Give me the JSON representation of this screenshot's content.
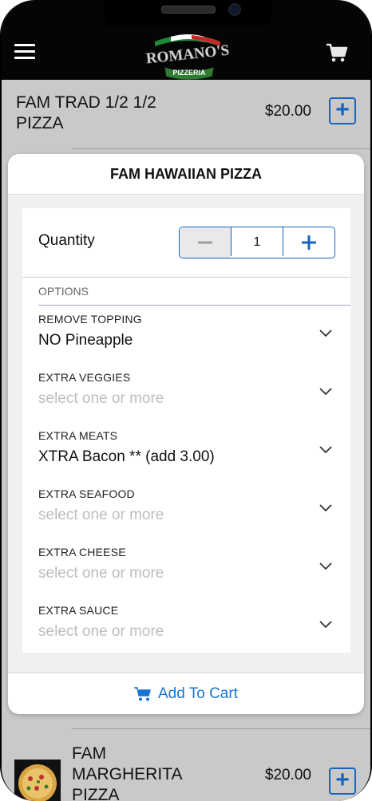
{
  "header": {
    "logo_text": "ROMANO'S",
    "logo_subtext": "PIZZERIA",
    "menu_icon": "hamburger-menu-icon",
    "cart_icon": "shopping-cart-icon"
  },
  "list": {
    "items": [
      {
        "title_line1": "FAM TRAD 1/2 1/2",
        "title_line2": "PIZZA",
        "price": "$20.00"
      },
      {
        "title_line1": "FAM",
        "title_line2": "MARGHERITA",
        "title_line3": "PIZZA",
        "price": "$20.00"
      }
    ]
  },
  "modal": {
    "title": "FAM HAWAIIAN PIZZA",
    "quantity_label": "Quantity",
    "quantity_value": "1",
    "options_header": "OPTIONS",
    "options": [
      {
        "label": "REMOVE TOPPING",
        "value": "NO Pineapple",
        "placeholder": false
      },
      {
        "label": "EXTRA VEGGIES",
        "value": "select one or more",
        "placeholder": true
      },
      {
        "label": "EXTRA MEATS",
        "value": "XTRA Bacon ** (add 3.00)",
        "placeholder": false
      },
      {
        "label": "EXTRA SEAFOOD",
        "value": "select one or more",
        "placeholder": true
      },
      {
        "label": "EXTRA CHEESE",
        "value": "select one or more",
        "placeholder": true
      },
      {
        "label": "EXTRA SAUCE",
        "value": "select one or more",
        "placeholder": true
      }
    ],
    "add_to_cart_label": "Add To Cart"
  },
  "colors": {
    "accent": "#1976d2",
    "header_bg": "#050505",
    "backdrop": "#c9c9c9",
    "placeholder": "#bdbdbd"
  }
}
